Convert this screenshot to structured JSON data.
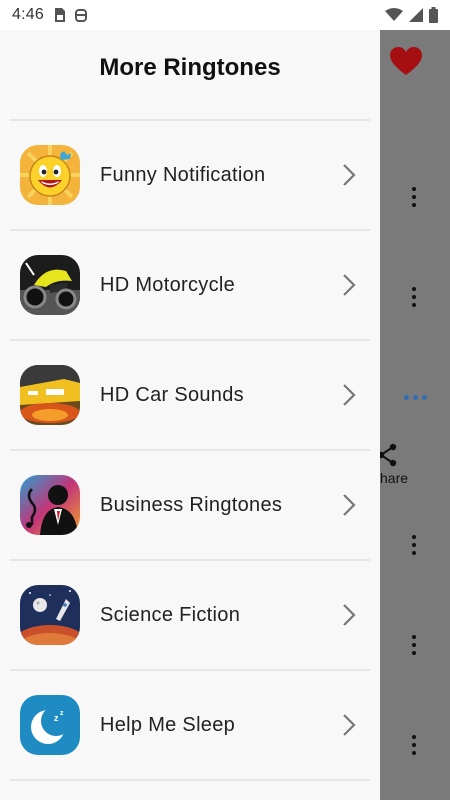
{
  "status_bar": {
    "time": "4:46",
    "icons_left": [
      "sim-card-icon",
      "notification-bot-icon"
    ],
    "icons_right": [
      "wifi-icon",
      "signal-icon",
      "battery-icon"
    ]
  },
  "background_app": {
    "share_label": "hare"
  },
  "drawer": {
    "title": "More Ringtones",
    "items": [
      {
        "label": "Funny Notification",
        "icon": "smiley-face-icon"
      },
      {
        "label": "HD Motorcycle",
        "icon": "motorcycle-icon"
      },
      {
        "label": "HD Car Sounds",
        "icon": "car-icon"
      },
      {
        "label": "Business Ringtones",
        "icon": "business-music-icon"
      },
      {
        "label": "Science Fiction",
        "icon": "rocket-planet-icon"
      },
      {
        "label": "Help Me Sleep",
        "icon": "moon-sleep-icon"
      }
    ]
  },
  "colors": {
    "drawer_bg": "#f8f8f8",
    "scrim": "#7a7a7a",
    "heart": "#a50f12",
    "accent_dots": "#2f6fb5"
  }
}
